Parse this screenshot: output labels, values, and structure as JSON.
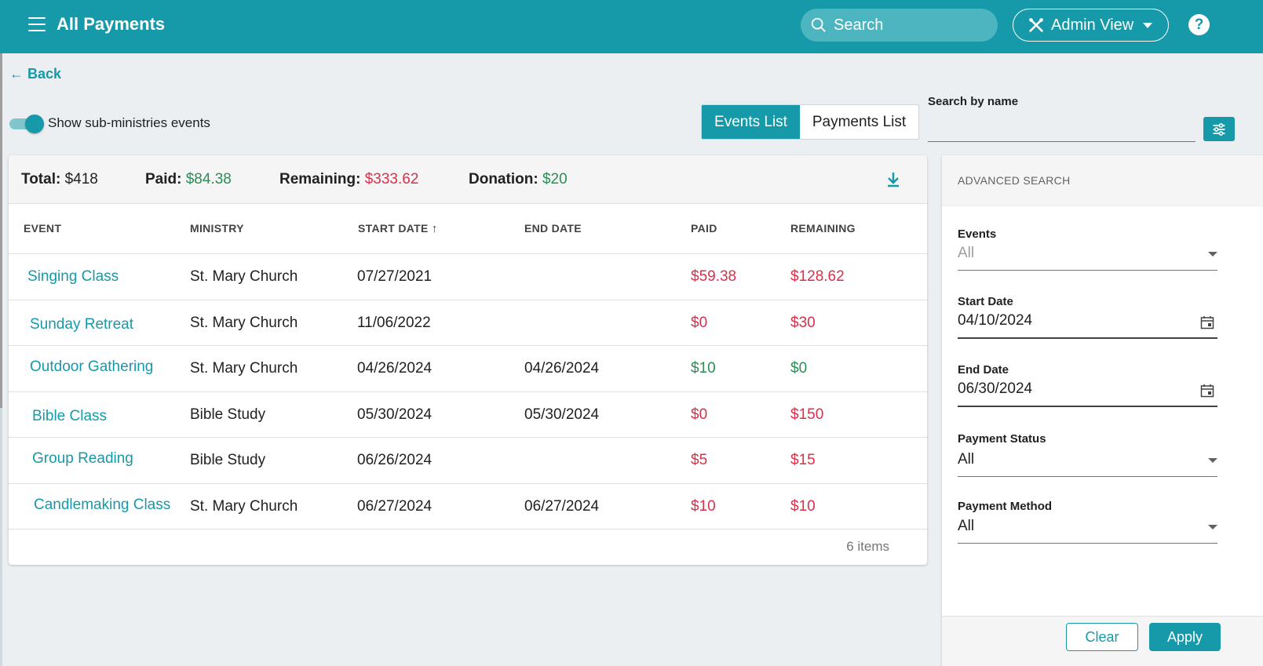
{
  "header": {
    "title": "All Payments",
    "search_placeholder": "Search",
    "admin_view_label": "Admin View",
    "help_label": "?"
  },
  "back_label": "Back",
  "toggle": {
    "label": "Show sub-ministries events",
    "on": true
  },
  "view_tabs": [
    {
      "label": "Events List",
      "active": true
    },
    {
      "label": "Payments List",
      "active": false
    }
  ],
  "search_by_name": {
    "label": "Search by name",
    "value": ""
  },
  "summary": {
    "total_label": "Total:",
    "total_value": "$418",
    "paid_label": "Paid:",
    "paid_value": "$84.38",
    "remaining_label": "Remaining:",
    "remaining_value": "$333.62",
    "donation_label": "Donation:",
    "donation_value": "$20"
  },
  "table": {
    "columns": [
      "EVENT",
      "MINISTRY",
      "START DATE",
      "END DATE",
      "PAID",
      "REMAINING"
    ],
    "sort": {
      "column": "START DATE",
      "direction": "ascending"
    },
    "rows": [
      {
        "event": "Singing Class",
        "ministry": "St. Mary Church",
        "start": "07/27/2021",
        "end": "",
        "paid": "$59.38",
        "remaining": "$128.62",
        "paid_status": "red",
        "remaining_status": "red"
      },
      {
        "event": "Sunday Retreat",
        "ministry": "St. Mary Church",
        "start": "11/06/2022",
        "end": "",
        "paid": "$0",
        "remaining": "$30",
        "paid_status": "red",
        "remaining_status": "red"
      },
      {
        "event": "Outdoor Gathering",
        "ministry": "St. Mary Church",
        "start": "04/26/2024",
        "end": "04/26/2024",
        "paid": "$10",
        "remaining": "$0",
        "paid_status": "green",
        "remaining_status": "green"
      },
      {
        "event": "Bible Class",
        "ministry": "Bible Study",
        "start": "05/30/2024",
        "end": "05/30/2024",
        "paid": "$0",
        "remaining": "$150",
        "paid_status": "red",
        "remaining_status": "red"
      },
      {
        "event": "Group Reading",
        "ministry": "Bible Study",
        "start": "06/26/2024",
        "end": "",
        "paid": "$5",
        "remaining": "$15",
        "paid_status": "red",
        "remaining_status": "red"
      },
      {
        "event": "Candlemaking Class",
        "ministry": "St. Mary Church",
        "start": "06/27/2024",
        "end": "06/27/2024",
        "paid": "$10",
        "remaining": "$10",
        "paid_status": "red",
        "remaining_status": "red"
      }
    ],
    "item_count": "6 items"
  },
  "advanced": {
    "title": "ADVANCED SEARCH",
    "events_label": "Events",
    "events_value": "All",
    "start_label": "Start Date",
    "start_value": "04/10/2024",
    "end_label": "End Date",
    "end_value": "06/30/2024",
    "status_label": "Payment Status",
    "status_value": "All",
    "method_label": "Payment Method",
    "method_value": "All",
    "clear_label": "Clear",
    "apply_label": "Apply"
  },
  "colors": {
    "brand": "#1699a8",
    "paid_green": "#2e8b57",
    "due_red": "#d9304a"
  }
}
